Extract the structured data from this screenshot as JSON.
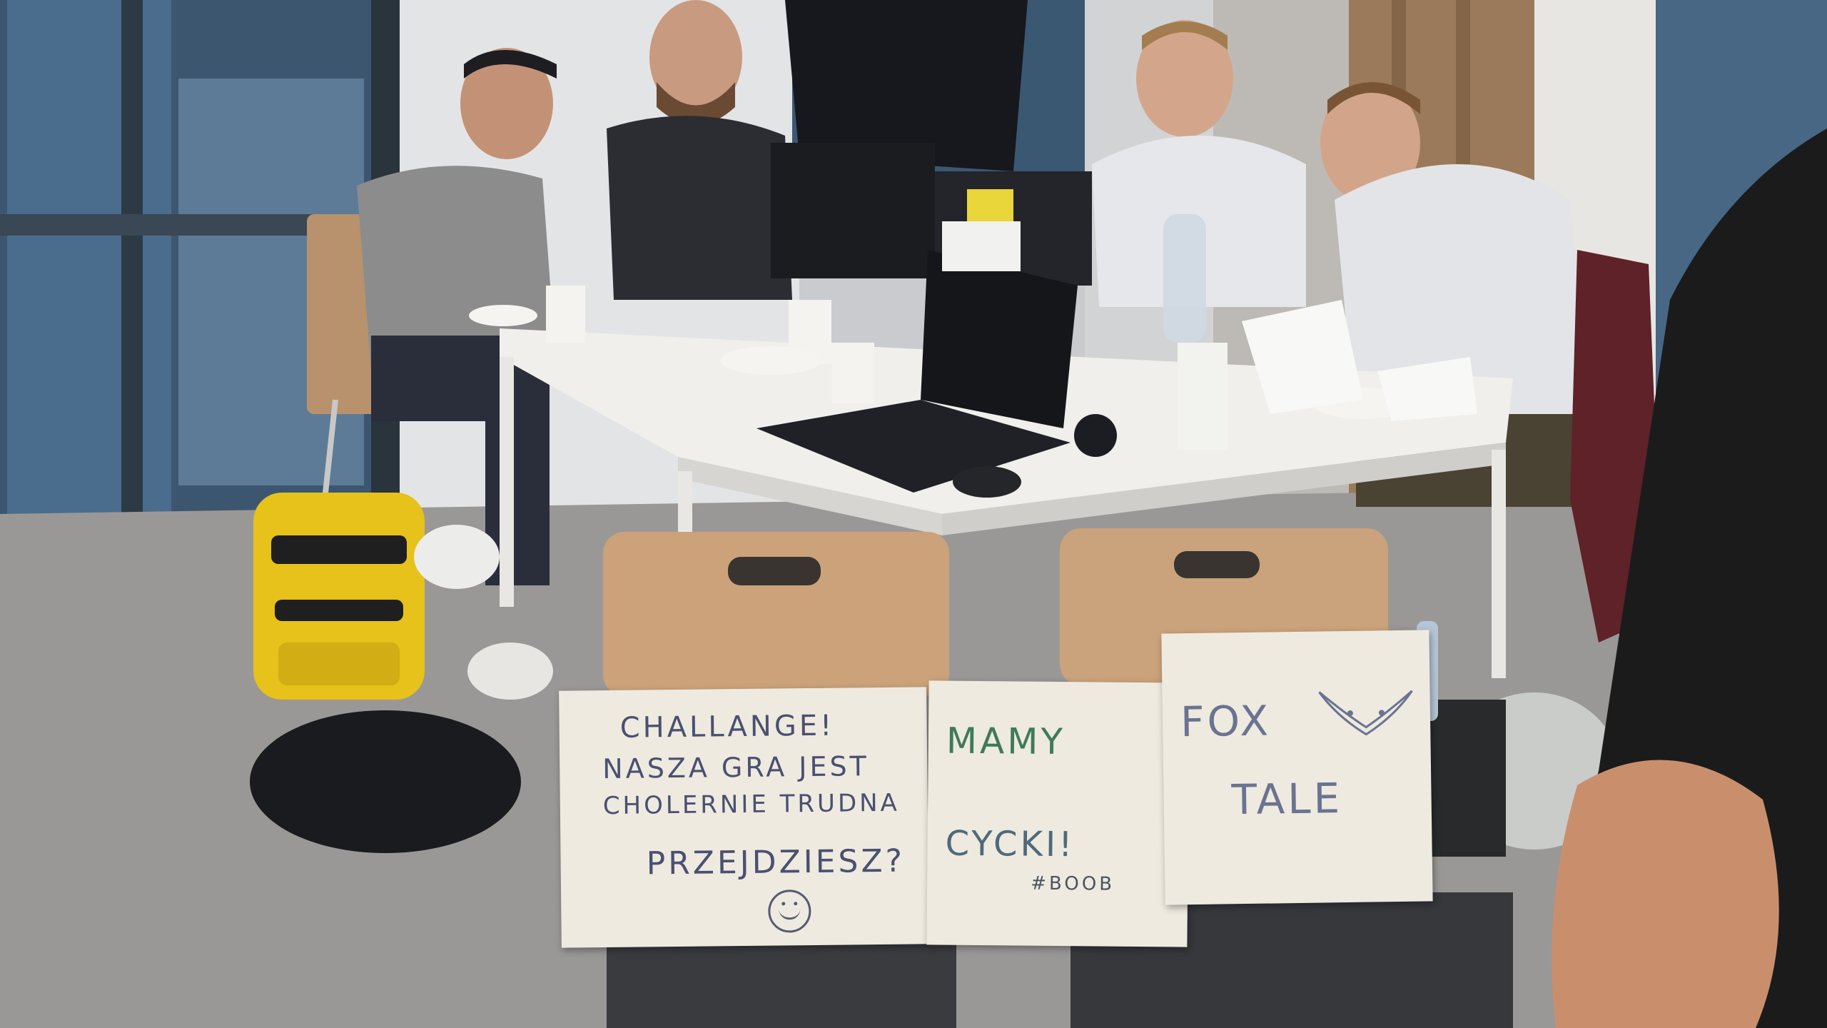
{
  "signs": {
    "challenge": {
      "line1": "CHALLANGE!",
      "line2": "NASZA GRA JEST",
      "line3": "CHOLERNIE TRUDNA",
      "line4": "PRZEJDZIESZ?"
    },
    "cycki": {
      "line1": "MAMY",
      "line2": "CYCKI!",
      "tag": "#BOOB"
    },
    "foxtale": {
      "line1": "FOX",
      "line2": "TALE"
    }
  },
  "icons": {
    "smiley": "smiley-face-icon",
    "fox": "fox-face-icon"
  },
  "colors": {
    "floor": "#9a9896",
    "table": "#f0efec",
    "backpack": "#e6c21a",
    "sign_paper": "#eeeae0",
    "green_marker": "#3f7a5a",
    "blue_marker": "#4a5070"
  }
}
